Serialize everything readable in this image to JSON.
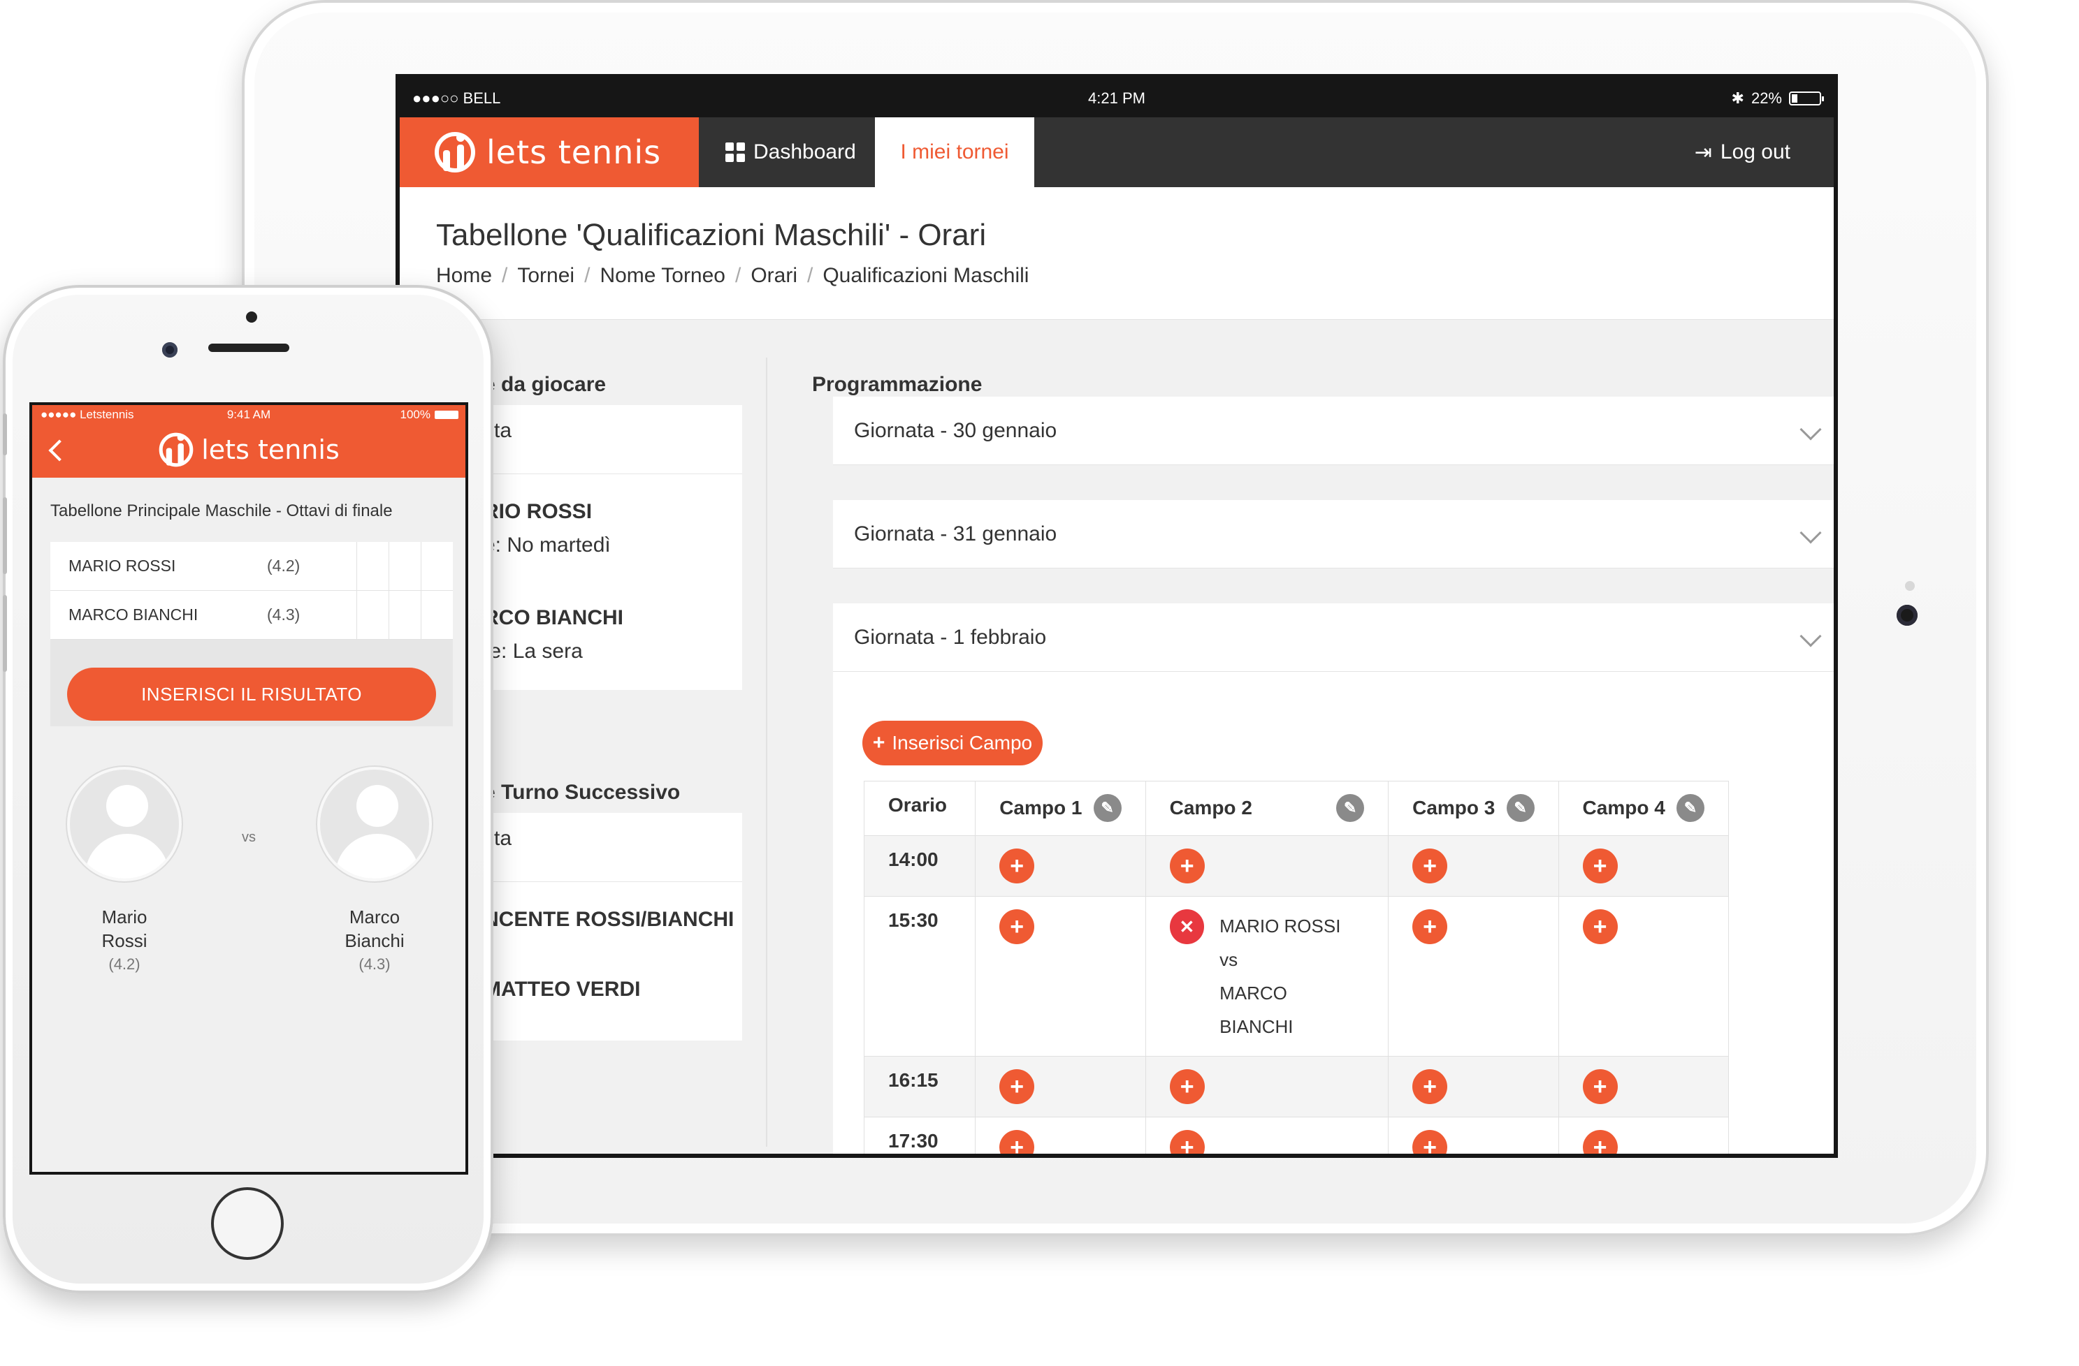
{
  "tablet": {
    "status": {
      "carrier": "●●●○○ BELL",
      "time": "4:21 PM",
      "battery": "22%",
      "battery_level": 0.22
    },
    "brand": "lets tennis",
    "nav": {
      "dashboard": "Dashboard",
      "tornei": "I miei tornei",
      "logout": "Log out"
    },
    "page_title": "Tabellone 'Qualificazioni Maschili' - Orari",
    "breadcrumb": [
      "Home",
      "Tornei",
      "Nome Torneo",
      "Orari",
      "Qualificazioni Maschili"
    ],
    "left": {
      "section1_title": "e da giocare",
      "section1_rows": [
        "tita",
        "RIO ROSSI",
        "e: No martedì",
        "RCO BIANCHI",
        "te: La sera"
      ],
      "section2_title": "e Turno Successivo",
      "section2_rows": [
        "tita",
        "NCENTE ROSSI/BIANCHI",
        "MATTEO VERDI"
      ]
    },
    "programmazione": {
      "title": "Programmazione",
      "days": [
        "Giornata - 30 gennaio",
        "Giornata - 31 gennaio",
        "Giornata - 1 febbraio"
      ],
      "add_campo": "Inserisci Campo",
      "columns": [
        "Orario",
        "Campo 1",
        "Campo 2",
        "Campo 3",
        "Campo 4"
      ],
      "times": [
        "14:00",
        "15:30",
        "16:15",
        "17:30"
      ],
      "match": {
        "player1": "MARIO ROSSI",
        "vs": "vs",
        "player2": "MARCO BIANCHI"
      }
    }
  },
  "phone": {
    "status": {
      "carrier": "●●●●● Letstennis",
      "time": "9:41 AM",
      "battery": "100%"
    },
    "brand": "lets tennis",
    "title": "Tabellone Principale Maschile - Ottavi di finale",
    "players": [
      {
        "name": "MARIO ROSSI",
        "rating": "(4.2)"
      },
      {
        "name": "MARCO BIANCHI",
        "rating": "(4.3)"
      }
    ],
    "button": "INSERISCI IL RISULTATO",
    "vs": "vs",
    "p1": {
      "first": "Mario",
      "last": "Rossi",
      "rating": "(4.2)"
    },
    "p2": {
      "first": "Marco",
      "last": "Bianchi",
      "rating": "(4.3)"
    }
  },
  "colors": {
    "accent": "#ef5a33",
    "nav": "#333333",
    "remove": "#e8383f"
  }
}
